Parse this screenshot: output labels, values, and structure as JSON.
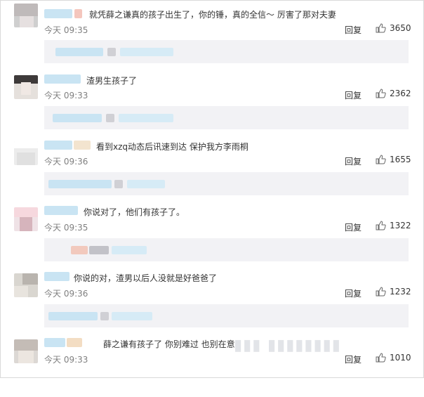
{
  "comments": [
    {
      "text": "就凭薛之谦真的孩子出生了，你的锤，真的全信～ 厉害了那对夫妻",
      "time": "今天 09:35",
      "reply": "回复",
      "likes": "3650"
    },
    {
      "text": "渣男生孩子了",
      "time": "今天 09:33",
      "reply": "回复",
      "likes": "2362"
    },
    {
      "text": "看到xzq动态后讯速到达 保护我方李雨桐",
      "time": "今天 09:36",
      "reply": "回复",
      "likes": "1655"
    },
    {
      "text": "你说对了，他们有孩子了。",
      "time": "今天 09:35",
      "reply": "回复",
      "likes": "1322"
    },
    {
      "text": "你说的对，渣男以后人没就是好爸爸了",
      "time": "今天 09:36",
      "reply": "回复",
      "likes": "1232"
    },
    {
      "text": "薛之谦有孩子了 你别难过 也别在意",
      "time": "今天 09:33",
      "reply": "回复",
      "likes": "1010"
    }
  ],
  "icons": {
    "like": "thumbs-up-icon"
  },
  "colors": {
    "subreply_bg": "#f2f2f5",
    "blur_blue": "#c9e4f3",
    "time_gray": "#808080"
  }
}
